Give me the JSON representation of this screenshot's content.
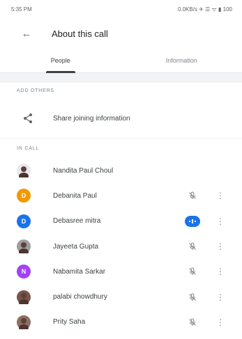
{
  "status_bar": {
    "time": "5:35 PM",
    "right_text": "0.0KB/s ✈ ☰ ᯤ ▮ 100"
  },
  "app_bar": {
    "title": "About this call"
  },
  "tabs": [
    {
      "label": "People",
      "active": true
    },
    {
      "label": "Information",
      "active": false
    }
  ],
  "sections": {
    "add_others": "ADD OTHERS",
    "in_call": "IN CALL"
  },
  "share": {
    "label": "Share joining information"
  },
  "people": [
    {
      "name": "Nandita Paul Choul",
      "avatar_color": "#e8eaed",
      "avatar_letter": "",
      "avatar_icon": "photo",
      "status_icon": "none"
    },
    {
      "name": "Debanita Paul",
      "avatar_color": "#f29900",
      "avatar_letter": "D",
      "avatar_icon": "letter",
      "status_icon": "mic-off"
    },
    {
      "name": "Debasree mitra",
      "avatar_color": "#1a73e8",
      "avatar_letter": "D",
      "avatar_icon": "letter",
      "status_icon": "speaking"
    },
    {
      "name": "Jayeeta Gupta",
      "avatar_color": "#9e9e9e",
      "avatar_letter": "",
      "avatar_icon": "photo",
      "status_icon": "mic-off"
    },
    {
      "name": "Nabamita Sarkar",
      "avatar_color": "#a142f4",
      "avatar_letter": "N",
      "avatar_icon": "letter",
      "status_icon": "mic-off"
    },
    {
      "name": "palabi chowdhury",
      "avatar_color": "#795548",
      "avatar_letter": "",
      "avatar_icon": "photo",
      "status_icon": "mic-off"
    },
    {
      "name": "Prity Saha",
      "avatar_color": "#8d6e63",
      "avatar_letter": "",
      "avatar_icon": "photo",
      "status_icon": "mic-off"
    }
  ],
  "colors": {
    "accent": "#1a73e8",
    "text": "#3c4043",
    "muted": "#80868b"
  }
}
